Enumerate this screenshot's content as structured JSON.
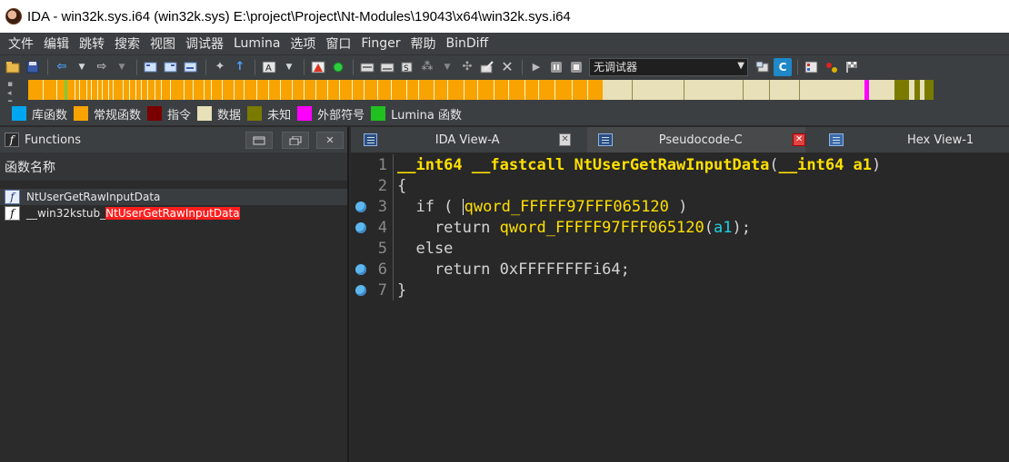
{
  "window": {
    "title": "IDA - win32k.sys.i64 (win32k.sys) E:\\project\\Project\\Nt-Modules\\19043\\x64\\win32k.sys.i64"
  },
  "menu": [
    "文件",
    "编辑",
    "跳转",
    "搜索",
    "视图",
    "调试器",
    "Lumina",
    "选项",
    "窗口",
    "Finger",
    "帮助",
    "BinDiff"
  ],
  "toolbar": {
    "debugger_select": "无调试器"
  },
  "legend": [
    {
      "label": "库函数",
      "color": "#00a6f0"
    },
    {
      "label": "常规函数",
      "color": "#f8a300"
    },
    {
      "label": "指令",
      "color": "#7a0000"
    },
    {
      "label": "数据",
      "color": "#e8e0b8"
    },
    {
      "label": "未知",
      "color": "#7a7a00"
    },
    {
      "label": "外部符号",
      "color": "#ff00ff"
    },
    {
      "label": "Lumina 函数",
      "color": "#20c020"
    }
  ],
  "functions": {
    "title": "Functions",
    "column": "函数名称",
    "items": [
      {
        "name": "NtUserGetRawInputData",
        "prefix": "",
        "highlight": ""
      },
      {
        "name": "",
        "prefix": "__win32kstub_",
        "highlight": "NtUserGetRawInputData"
      }
    ]
  },
  "tabs": [
    {
      "label": "IDA View-A"
    },
    {
      "label": "Pseudocode-C"
    },
    {
      "label": "Hex View-1"
    }
  ],
  "code": {
    "line_numbers": [
      "1",
      "2",
      "3",
      "4",
      "5",
      "6",
      "7"
    ],
    "l1": [
      "__int64 __fastcall NtUserGetRawInputData",
      "(",
      "__int64 a1",
      ")"
    ],
    "l2": "{",
    "l3": [
      "  if ( ",
      "qword_FFFFF97FFF065120",
      " )"
    ],
    "l4": [
      "    return ",
      "qword_FFFFF97FFF065120",
      "(",
      "a1",
      ");"
    ],
    "l5": "  else",
    "l6": [
      "    return ",
      "0xFFFFFFFFi64",
      ";"
    ],
    "l7": "}"
  }
}
